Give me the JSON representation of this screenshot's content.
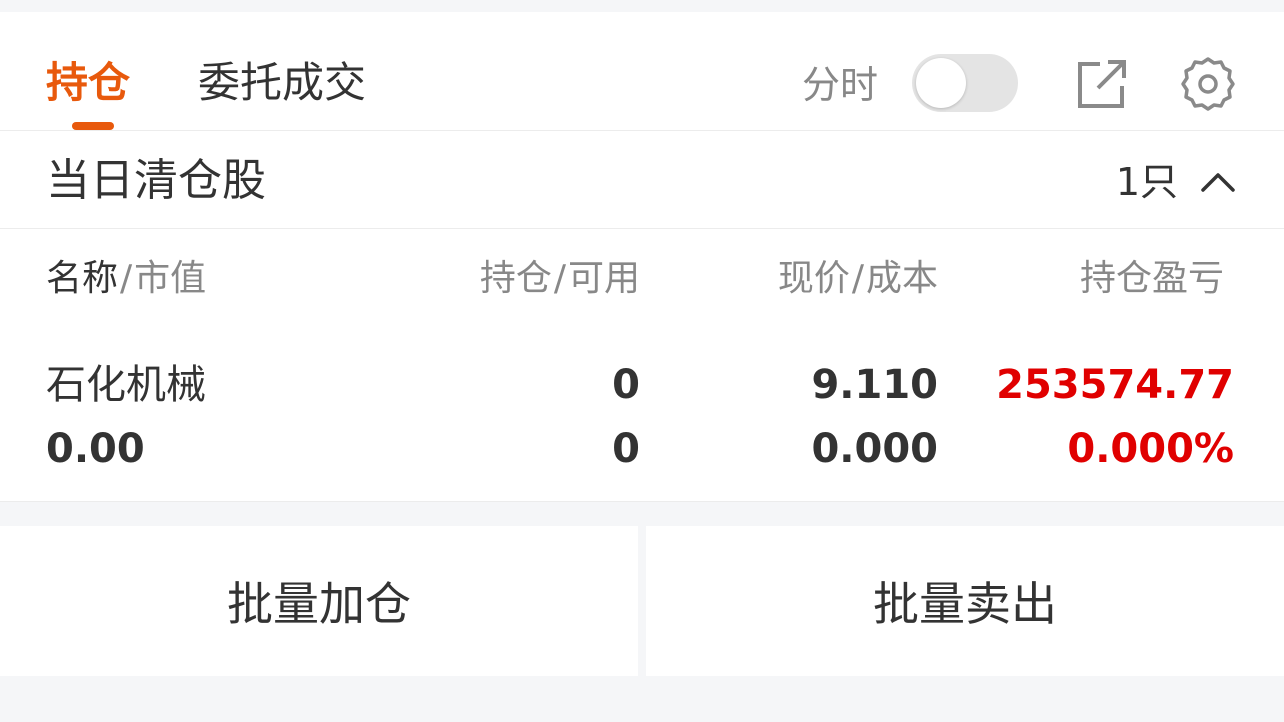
{
  "tabs": {
    "holdings": "持仓",
    "orders": "委托成交"
  },
  "toolbar": {
    "timeshare_label": "分时",
    "timeshare_on": false,
    "share_icon": "external-link-icon",
    "settings_icon": "gear-icon"
  },
  "section": {
    "title": "当日清仓股",
    "count": "1只",
    "expanded": true
  },
  "columns": {
    "name": "名称",
    "market_value": "市值",
    "holdings": "持仓",
    "available": "可用",
    "price": "现价",
    "cost": "成本",
    "pnl": "持仓盈亏"
  },
  "rows": [
    {
      "name": "石化机械",
      "market_value": "0.00",
      "holdings": "0",
      "available": "0",
      "price": "9.110",
      "cost": "0.000",
      "pnl": "253574.77",
      "pnl_pct": "0.000%"
    }
  ],
  "actions": {
    "batch_add": "批量加仓",
    "batch_sell": "批量卖出"
  },
  "colors": {
    "accent": "#e8590c",
    "profit": "#e00000",
    "text": "#333333",
    "muted": "#888888"
  }
}
